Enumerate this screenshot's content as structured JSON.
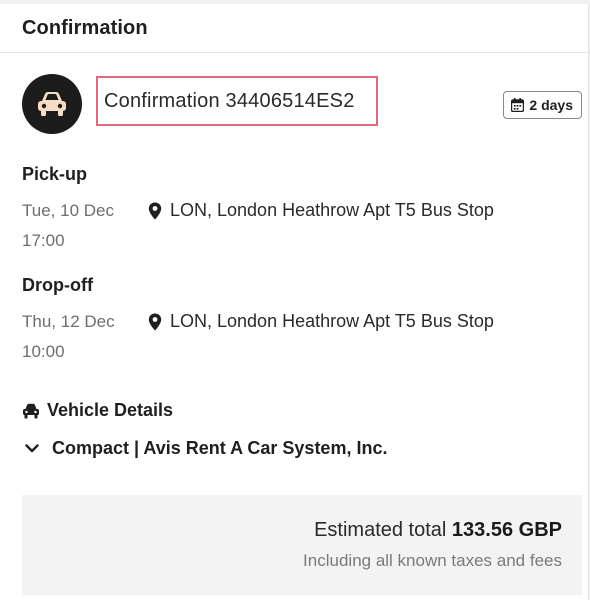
{
  "header": {
    "title": "Confirmation"
  },
  "confirmation": {
    "label": "Confirmation 34406514ES2",
    "avatar_icon": "car-icon",
    "duration_icon": "calendar-icon",
    "duration": "2 days",
    "highlight_color": "#e06a7f"
  },
  "pickup": {
    "label": "Pick-up",
    "date": "Tue, 10 Dec",
    "time": "17:00",
    "location_icon": "map-pin-icon",
    "location": "LON, London Heathrow Apt T5 Bus Stop"
  },
  "dropoff": {
    "label": "Drop-off",
    "date": "Thu, 12 Dec",
    "time": "10:00",
    "location_icon": "map-pin-icon",
    "location": "LON, London Heathrow Apt T5 Bus Stop"
  },
  "vehicle": {
    "heading_icon": "car-icon",
    "heading": "Vehicle Details",
    "toggle_icon": "chevron-down-icon",
    "summary": "Compact | Avis Rent A Car System, Inc."
  },
  "total": {
    "label": "Estimated total",
    "amount": "133.56 GBP",
    "note": "Including all known taxes and fees"
  }
}
